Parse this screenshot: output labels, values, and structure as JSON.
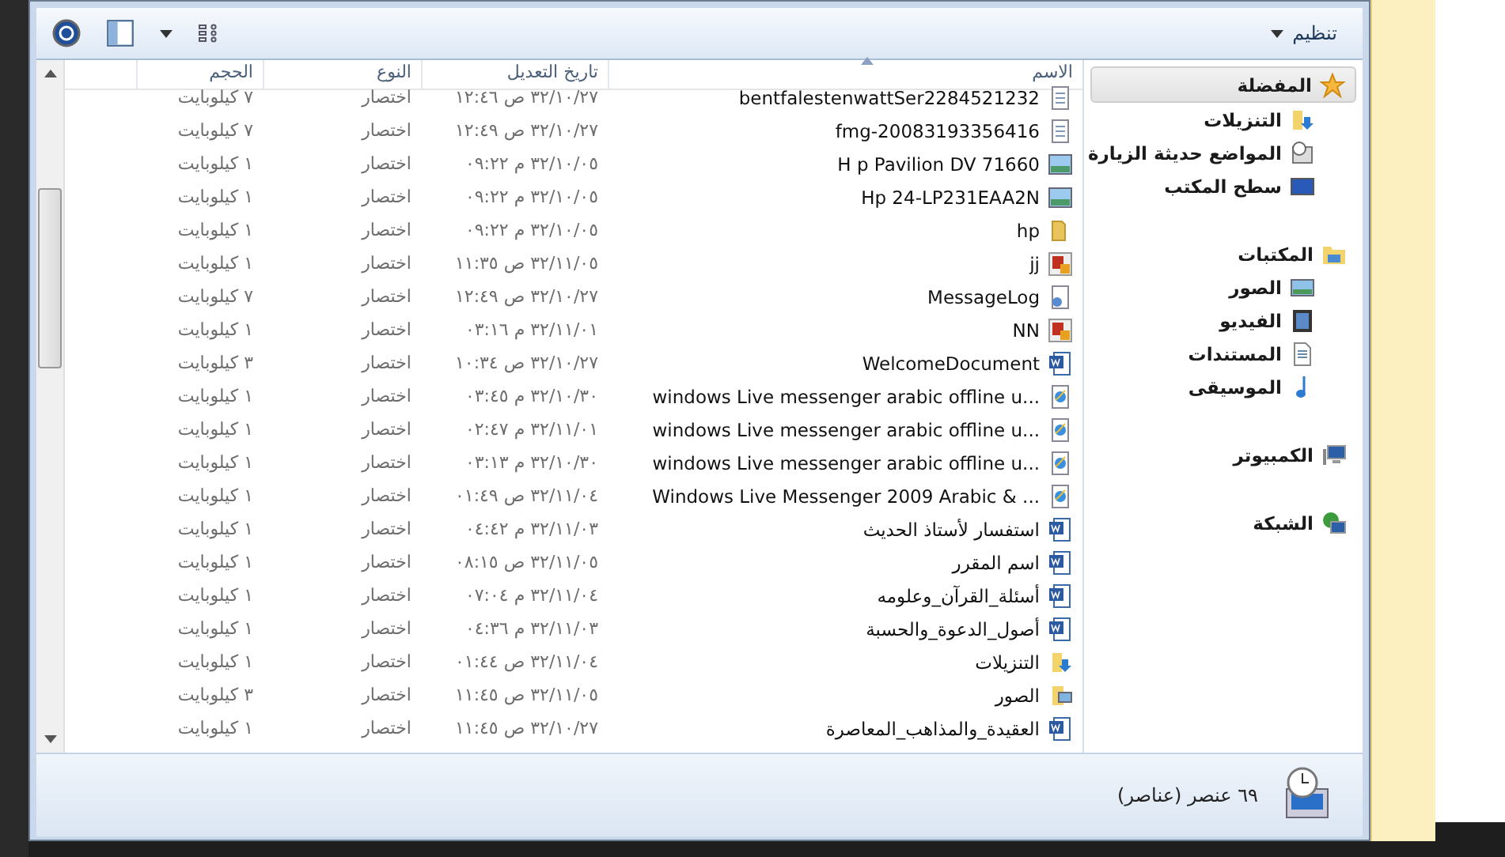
{
  "toolbar": {
    "organize": "تنظيم"
  },
  "columns": [
    "الاسم",
    "تاريخ التعديل",
    "النوع",
    "الحجم"
  ],
  "rows": [
    {
      "name": "bentfalestenwattSer2284521232",
      "kind": "shortcut",
      "date": "١٢:٤٦ ص ٣٢/١٠/٢٧",
      "type": "اختصار",
      "size": "٧ كيلوبايت"
    },
    {
      "name": "fmg-20083193356416",
      "kind": "shortcut",
      "date": "١٢:٤٩ ص ٣٢/١٠/٢٧",
      "type": "اختصار",
      "size": "٧ كيلوبايت"
    },
    {
      "name": "H p Pavilion DV 71660",
      "kind": "image",
      "date": "٠٩:٢٢ م ٣٢/١٠/٠٥",
      "type": "اختصار",
      "size": "١ كيلوبايت"
    },
    {
      "name": "Hp 24-LP231EAA2N",
      "kind": "image",
      "date": "٠٩:٢٢ م ٣٢/١٠/٠٥",
      "type": "اختصار",
      "size": "١ كيلوبايت"
    },
    {
      "name": "hp",
      "kind": "folder",
      "date": "٠٩:٢٢ م ٣٢/١٠/٠٥",
      "type": "اختصار",
      "size": "١ كيلوبايت"
    },
    {
      "name": "jj",
      "kind": "app",
      "date": "١١:٣٥ ص ٣٢/١١/٠٥",
      "type": "اختصار",
      "size": "١ كيلوبايت"
    },
    {
      "name": "MessageLog",
      "kind": "settings",
      "date": "١٢:٤٩ ص ٣٢/١٠/٢٧",
      "type": "اختصار",
      "size": "٧ كيلوبايت"
    },
    {
      "name": "NN",
      "kind": "app",
      "date": "٠٣:١٦ م ٣٢/١١/٠١",
      "type": "اختصار",
      "size": "١ كيلوبايت"
    },
    {
      "name": "WelcomeDocument",
      "kind": "word",
      "date": "١٠:٣٤ ص ٣٢/١٠/٢٧",
      "type": "اختصار",
      "size": "٣ كيلوبايت"
    },
    {
      "name": "windows Live messenger  arabic offline u...",
      "kind": "web",
      "date": "٠٣:٤٥ م ٣٢/١٠/٣٠",
      "type": "اختصار",
      "size": "١ كيلوبايت"
    },
    {
      "name": "windows Live messenger  arabic offline u...",
      "kind": "web",
      "date": "٠٢:٤٧ م ٣٢/١١/٠١",
      "type": "اختصار",
      "size": "١ كيلوبايت"
    },
    {
      "name": "windows Live messenger  arabic offline u...",
      "kind": "web",
      "date": "٠٣:١٣ م ٣٢/١٠/٣٠",
      "type": "اختصار",
      "size": "١ كيلوبايت"
    },
    {
      "name": "Windows Live Messenger 2009 Arabic & ...",
      "kind": "web",
      "date": "٠١:٤٩ ص ٣٢/١١/٠٤",
      "type": "اختصار",
      "size": "١ كيلوبايت"
    },
    {
      "name": "استفسار لأستاذ الحديث",
      "kind": "word",
      "date": "٠٤:٤٢ م ٣٢/١١/٠٣",
      "type": "اختصار",
      "size": "١ كيلوبايت"
    },
    {
      "name": "اسم المقرر",
      "kind": "word",
      "date": "٠٨:١٥ ص ٣٢/١١/٠٥",
      "type": "اختصار",
      "size": "١ كيلوبايت"
    },
    {
      "name": "أسئلة_القرآن_وعلومه",
      "kind": "word",
      "date": "٠٧:٠٤ م ٣٢/١١/٠٤",
      "type": "اختصار",
      "size": "١ كيلوبايت"
    },
    {
      "name": "أصول_الدعوة_والحسبة",
      "kind": "word",
      "date": "٠٤:٣٦ م ٣٢/١١/٠٣",
      "type": "اختصار",
      "size": "١ كيلوبايت"
    },
    {
      "name": "التنزيلات",
      "kind": "downloads",
      "date": "٠١:٤٤ ص ٣٢/١١/٠٤",
      "type": "اختصار",
      "size": "١ كيلوبايت"
    },
    {
      "name": "الصور",
      "kind": "pictures",
      "date": "١١:٤٥ ص ٣٢/١١/٠٥",
      "type": "اختصار",
      "size": "٣ كيلوبايت"
    },
    {
      "name": "العقيدة_والمذاهب_المعاصرة",
      "kind": "word",
      "date": "١١:٤٥ ص ٣٢/١٠/٢٧",
      "type": "اختصار",
      "size": "١ كيلوبايت"
    }
  ],
  "sidebar": [
    {
      "label": "المفضلة",
      "kind": "star",
      "selected": true,
      "children": [
        {
          "label": "التنزيلات",
          "kind": "downloads",
          "selected": false
        },
        {
          "label": "المواضع حديثة الزيارة",
          "kind": "recent",
          "selected": false
        },
        {
          "label": "سطح المكتب",
          "kind": "desktop",
          "selected": false
        }
      ]
    },
    {
      "label": "المكتبات",
      "kind": "library",
      "selected": false,
      "children": [
        {
          "label": "الصور",
          "kind": "image",
          "selected": false
        },
        {
          "label": "الفيديو",
          "kind": "video",
          "selected": false
        },
        {
          "label": "المستندات",
          "kind": "document",
          "selected": false
        },
        {
          "label": "الموسيقى",
          "kind": "music",
          "selected": false
        }
      ]
    },
    {
      "label": "الكمبيوتر",
      "kind": "computer",
      "selected": false
    },
    {
      "label": "الشبكة",
      "kind": "network",
      "selected": false
    }
  ],
  "status": "٦٩ عنصر (عناصر)"
}
